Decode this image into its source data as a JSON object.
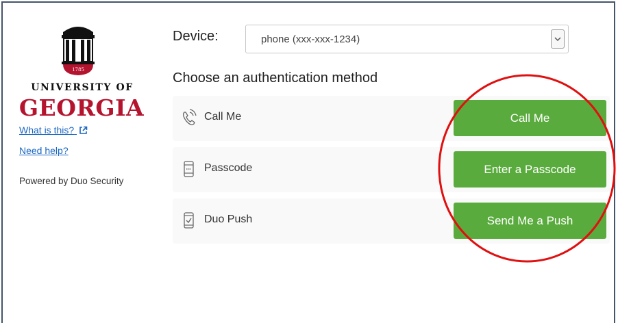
{
  "brand": {
    "badge_year": "1785",
    "university_of": "UNIVERSITY OF",
    "georgia": "GEORGIA",
    "brand_color": "#b5142f",
    "what_is_this": "What is this?",
    "need_help": "Need help?",
    "powered_by": "Powered by Duo Security"
  },
  "device": {
    "label": "Device:",
    "selected": "phone (xxx-xxx-1234)"
  },
  "auth": {
    "title": "Choose an authentication method",
    "button_color": "#5aab3d",
    "methods": [
      {
        "icon": "phone-call-icon",
        "label": "Call Me",
        "button": "Call Me"
      },
      {
        "icon": "passcode-device-icon",
        "label": "Passcode",
        "button": "Enter a Passcode"
      },
      {
        "icon": "push-phone-icon",
        "label": "Duo Push",
        "button": "Send Me a Push"
      }
    ]
  },
  "annotation": {
    "shape": "circle",
    "color": "#e01010"
  }
}
